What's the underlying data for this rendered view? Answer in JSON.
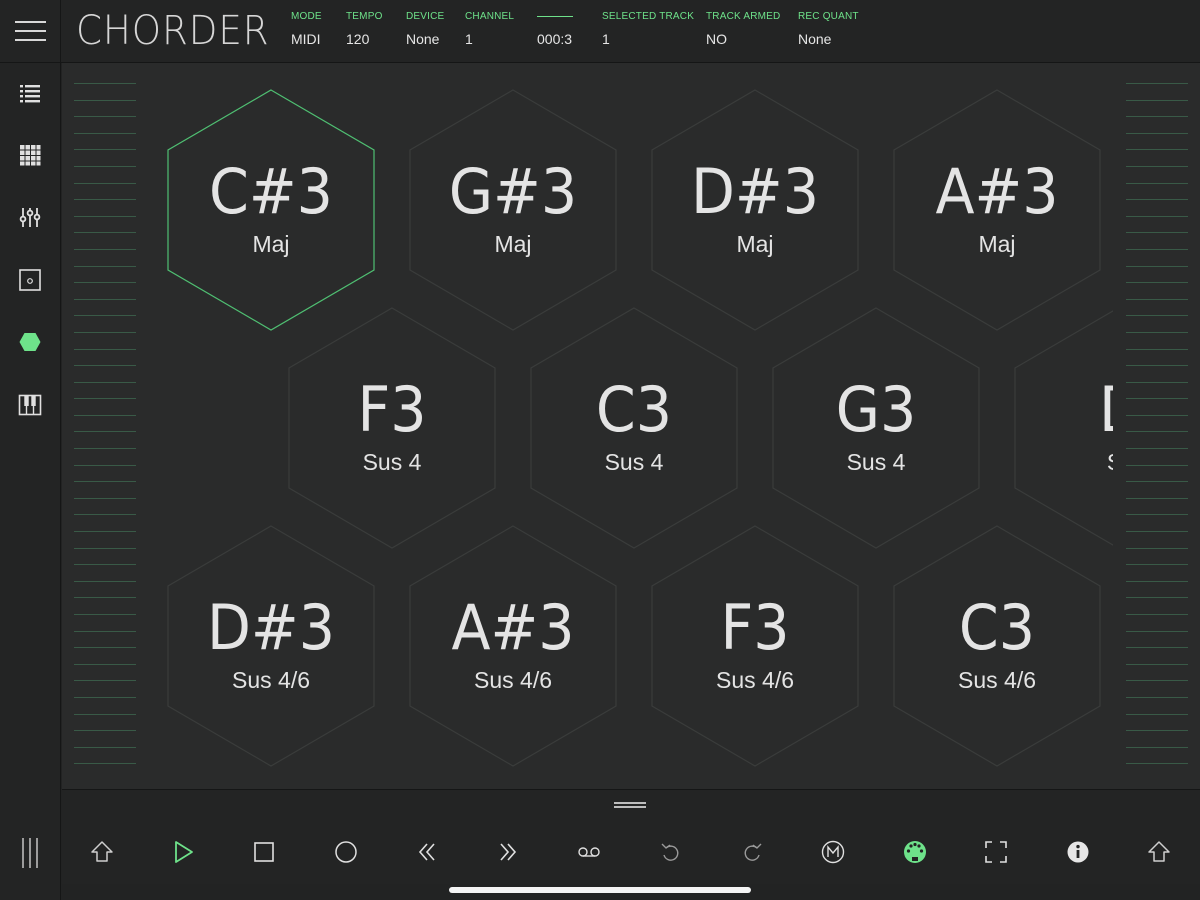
{
  "app": {
    "title": "CHORDER"
  },
  "status": {
    "mode": {
      "label": "MODE",
      "value": "MIDI"
    },
    "tempo": {
      "label": "TEMPO",
      "value": "120"
    },
    "device": {
      "label": "DEVICE",
      "value": "None"
    },
    "channel": {
      "label": "CHANNEL",
      "value": "1"
    },
    "position": {
      "value": "000:3"
    },
    "selected_track": {
      "label": "SELECTED TRACK",
      "value": "1"
    },
    "track_armed": {
      "label": "TRACK ARMED",
      "value": "NO"
    },
    "rec_quant": {
      "label": "REC QUANT",
      "value": "None"
    }
  },
  "colors": {
    "accent": "#6ee28a",
    "background": "#2a2b2b",
    "panel": "#232424",
    "hex_stroke": "#3a3c3b",
    "hex_selected_stroke": "#4fbf72"
  },
  "sidebar": {
    "items": [
      {
        "icon": "list-icon",
        "active": false
      },
      {
        "icon": "grid-icon",
        "active": false
      },
      {
        "icon": "mixer-sliders-icon",
        "active": false
      },
      {
        "icon": "pad-square-icon",
        "active": false
      },
      {
        "icon": "hexagon-icon",
        "active": true
      },
      {
        "icon": "piano-keys-icon",
        "active": false
      }
    ],
    "bottom_icon": "vertical-lines-icon"
  },
  "pads": {
    "row1": [
      {
        "note": "C#3",
        "quality": "Maj",
        "selected": true
      },
      {
        "note": "G#3",
        "quality": "Maj",
        "selected": false
      },
      {
        "note": "D#3",
        "quality": "Maj",
        "selected": false
      },
      {
        "note": "A#3",
        "quality": "Maj",
        "selected": false
      }
    ],
    "row2": [
      {
        "note": "F3",
        "quality": "Sus 4",
        "selected": false
      },
      {
        "note": "C3",
        "quality": "Sus 4",
        "selected": false
      },
      {
        "note": "G3",
        "quality": "Sus 4",
        "selected": false
      },
      {
        "note": "D",
        "quality": "Su",
        "selected": false
      }
    ],
    "row3": [
      {
        "note": "D#3",
        "quality": "Sus 4/6",
        "selected": false
      },
      {
        "note": "A#3",
        "quality": "Sus 4/6",
        "selected": false
      },
      {
        "note": "F3",
        "quality": "Sus 4/6",
        "selected": false
      },
      {
        "note": "C3",
        "quality": "Sus 4/6",
        "selected": false
      }
    ]
  },
  "transport": {
    "buttons": [
      "shift-up-icon",
      "play-icon",
      "stop-icon",
      "record-icon",
      "rewind-icon",
      "fast-forward-icon",
      "tape-loop-icon",
      "undo-icon",
      "redo-icon",
      "metronome-m-icon",
      "midi-din-icon",
      "fullscreen-icon",
      "info-icon",
      "shift-up-icon"
    ]
  }
}
